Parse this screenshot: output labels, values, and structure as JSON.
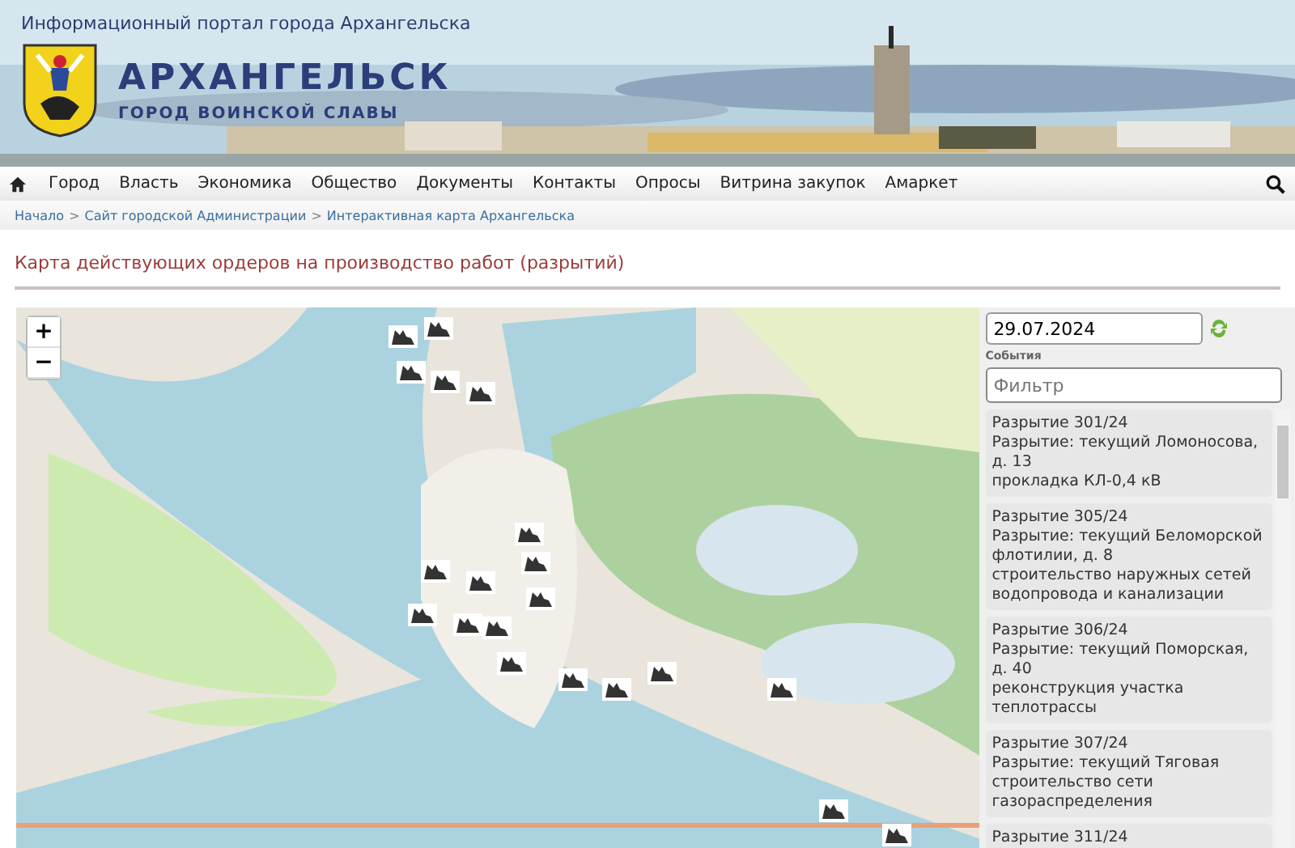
{
  "header": {
    "portal_title": "Информационный портал города Архангельска",
    "city_name": "АРХАНГЕЛЬСК",
    "city_motto": "ГОРОД ВОИНСКОЙ СЛАВЫ"
  },
  "nav": {
    "items": [
      "Город",
      "Власть",
      "Экономика",
      "Общество",
      "Документы",
      "Контакты",
      "Опросы",
      "Витрина закупок",
      "Амаркет"
    ]
  },
  "breadcrumbs": [
    "Начало",
    "Сайт городской Администрации",
    "Интерактивная карта Архангельска"
  ],
  "breadcrumb_separator": ">",
  "page_title": "Карта действующих ордеров на производство работ (разрытий)",
  "map": {
    "zoom_in": "+",
    "zoom_out": "−"
  },
  "sidebar": {
    "date": "29.07.2024",
    "events_label": "События",
    "filter_placeholder": "Фильтр",
    "events": [
      {
        "title": "Разрытие 301/24",
        "lines": [
          "Разрытие: текущий Ломоносова, д. 13",
          "прокладка КЛ-0,4 кВ"
        ]
      },
      {
        "title": "Разрытие 305/24",
        "lines": [
          "Разрытие: текущий Беломорской флотилии, д. 8",
          "строительство наружных сетей водопровода и канализации"
        ]
      },
      {
        "title": "Разрытие 306/24",
        "lines": [
          "Разрытие: текущий Поморская, д. 40",
          "реконструкция участка теплотрассы"
        ]
      },
      {
        "title": "Разрытие 307/24",
        "lines": [
          "Разрытие: текущий Тяговая",
          "строительство сети газораспределения"
        ]
      },
      {
        "title": "Разрытие 311/24"
      }
    ]
  }
}
